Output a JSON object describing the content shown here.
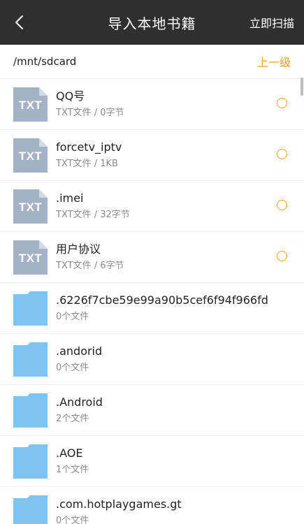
{
  "header": {
    "title": "导入本地书籍",
    "scan_label": "立即扫描"
  },
  "pathbar": {
    "path": "/mnt/sdcard",
    "up_label": "上一级"
  },
  "icons": {
    "txt_label": "TXT"
  },
  "colors": {
    "titlebar": "#2f2f2f",
    "accent": "#f3a014",
    "txt_icon": "#a3b2c6",
    "folder_icon": "#7ec4f3"
  },
  "files": [
    {
      "name": "QQ号",
      "meta": "TXT文件 / 0字节",
      "type": "txt"
    },
    {
      "name": "forcetv_iptv",
      "meta": "TXT文件 / 1KB",
      "type": "txt"
    },
    {
      "name": ".imei",
      "meta": "TXT文件 / 32字节",
      "type": "txt"
    },
    {
      "name": "用户协议",
      "meta": "TXT文件 / 6字节",
      "type": "txt"
    },
    {
      "name": ".6226f7cbe59e99a90b5cef6f94f966fd",
      "meta": "0个文件",
      "type": "folder"
    },
    {
      "name": ".andorid",
      "meta": "0个文件",
      "type": "folder"
    },
    {
      "name": ".Android",
      "meta": "2个文件",
      "type": "folder"
    },
    {
      "name": ".AOE",
      "meta": "1个文件",
      "type": "folder"
    },
    {
      "name": ".com.hotplaygames.gt",
      "meta": "0个文件",
      "type": "folder"
    }
  ]
}
